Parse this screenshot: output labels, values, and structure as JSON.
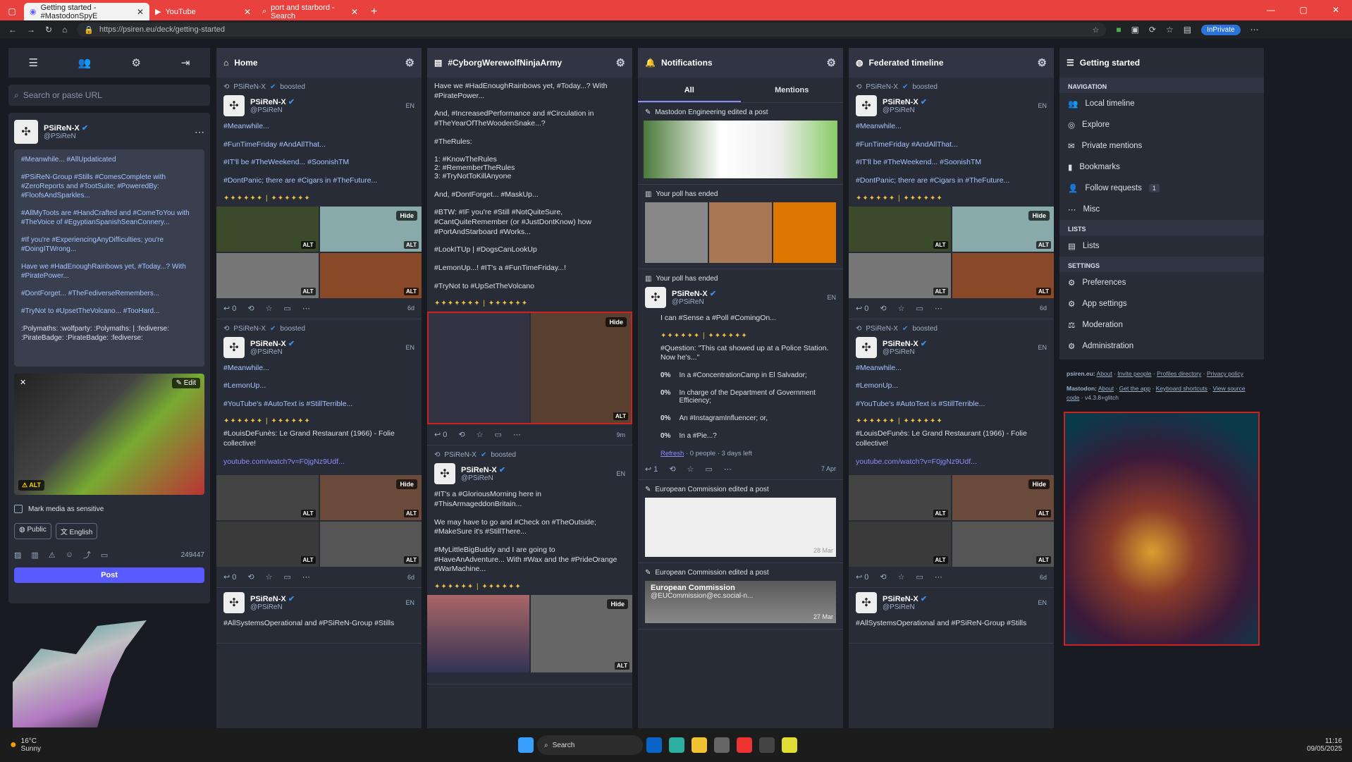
{
  "browser": {
    "tabs": [
      {
        "label": "Getting started - #MastodonSpyE",
        "active": true
      },
      {
        "label": "YouTube",
        "active": false
      },
      {
        "label": "port and starbord - Search",
        "active": false
      }
    ],
    "url": "https://psiren.eu/deck/getting-started",
    "private_label": "InPrivate",
    "colors": {
      "titlebar": "#e8413e"
    }
  },
  "compose": {
    "search_placeholder": "Search or paste URL",
    "user_name": "PSiReN-X",
    "user_handle": "@PSiReN",
    "draft": [
      "#Meanwhile... #AllUpdaticated",
      "#PSiReN-Group #Stills #ComesComplete with #ZeroReports and #TootSuite; #PoweredBy: #FloofsAndSparkles...",
      "#AllMyToots are #HandCrafted and #ComeToYou with #TheVoice of #EgyptianSpanishSeanConnery...",
      "#If you're #ExperiencingAnyDifficulties; you're #DoingITWrong...",
      "Have we #HadEnoughRainbows yet, #Today...? With #PiratePower...",
      "#DontForget... #TheFediverseRemembers...",
      "#TryNot to #UpsetTheVolcano... #TooHard...",
      ":Polymaths: :wolfparty: :Polymaths: | :fediverse: :PirateBadge: :PirateBadge: :fediverse:"
    ],
    "edit_label": "Edit",
    "alt_label": "ALT",
    "sensitive_label": "Mark media as sensitive",
    "visibility": "Public",
    "language": "English",
    "char_count": "249447",
    "post_label": "Post"
  },
  "home": {
    "title": "Home",
    "statuses": [
      {
        "boost": "PSiReN-X",
        "boosted": "boosted",
        "name": "PSiReN-X",
        "handle": "@PSiReN",
        "lang": "EN",
        "lines": [
          "#Meanwhile...",
          "#FunTimeFriday #AndAllThat...",
          "#IT'll be #TheWeekend... #SoonishTM",
          "#DontPanic; there are #Cigars in #TheFuture..."
        ],
        "time": "6d",
        "reply": "0"
      },
      {
        "boost": "PSiReN-X",
        "boosted": "boosted",
        "name": "PSiReN-X",
        "handle": "@PSiReN",
        "lang": "EN",
        "lines": [
          "#Meanwhile...",
          "#LemonUp...",
          "#YouTube's #AutoText is #StillTerrible...",
          "#LouisDeFunès: Le Grand Restaurant (1966) - Folie collective!"
        ],
        "link": "youtube.com/watch?v=F0jgNz9Udf...",
        "time": "6d",
        "reply": "0"
      },
      {
        "name": "PSiReN-X",
        "handle": "@PSiReN",
        "lang": "EN",
        "lines": [
          "#AllSystemsOperational and #PSiReN-Group #Stills"
        ]
      }
    ]
  },
  "hashtag": {
    "title": "#CyborgWerewolfNinjaArmy",
    "lines": [
      "Have we #HadEnoughRainbows yet, #Today...? With #PiratePower...",
      "And, #IncreasedPerformance and #Circulation in #TheYearOfTheWoodenSnake...?",
      "#TheRules:",
      "1: #KnowTheRules",
      "2: #RememberTheRules",
      "3: #TryNotToKillAnyone",
      "And, #DontForget... #MaskUp...",
      "#BTW: #IF you're #Still #NotQuiteSure, #CantQuiteRemember (or #JustDontKnow) how #PortAndStarboard #Works...",
      "#LookITUp | #DogsCanLookUp",
      "#LemonUp...! #IT's a #FunTimeFriday...!",
      "#TryNot to #UpSetTheVolcano"
    ],
    "time1": "9m",
    "reply1": "0",
    "boost": "PSiReN-X",
    "boosted": "boosted",
    "name": "PSiReN-X",
    "handle": "@PSiReN",
    "lang": "EN",
    "lines2": [
      "#IT's a #GloriousMorning here in #ThisArmageddonBritain...",
      "We may have to go and #Check on #TheOutside; #MakeSure it's #StillThere...",
      "#MyLittleBigBuddy and I are going to #HaveAnAdventure... With #Wax and the #PrideOrange #WarMachine..."
    ]
  },
  "notifications": {
    "title": "Notifications",
    "tab_all": "All",
    "tab_mentions": "Mentions",
    "n1": "Mastodon Engineering edited a post",
    "n2": "Your poll has ended",
    "n3": "Your poll has ended",
    "name": "PSiReN-X",
    "handle": "@PSiReN",
    "lang": "EN",
    "text1": "I can #Sense a #Poll #ComingOn...",
    "question": "#Question: \"This cat showed up at a Police Station. Now he's...\"",
    "poll": [
      {
        "pct": "0%",
        "label": "In a #ConcentrationCamp in El Salvador;"
      },
      {
        "pct": "0%",
        "label": "In charge of the Department of Government Efficiency;"
      },
      {
        "pct": "0%",
        "label": "An #InstagramInfluencer; or,"
      },
      {
        "pct": "0%",
        "label": "In a #Pie...?"
      }
    ],
    "refresh": "Refresh",
    "poll_meta": "· 0 people · 3 days left",
    "time": "7 Apr",
    "reply": "1",
    "n4": "European Commission edited a post",
    "n5": "European Commission edited a post",
    "eu_name": "European Commission",
    "eu_handle": "@EUCommission@ec.social-n...",
    "eu_time1": "28 Mar",
    "eu_time2": "27 Mar"
  },
  "federated": {
    "title": "Federated timeline"
  },
  "getting_started": {
    "title": "Getting started",
    "nav_header": "NAVIGATION",
    "nav": [
      "Local timeline",
      "Explore",
      "Private mentions",
      "Bookmarks",
      "Follow requests",
      "Misc"
    ],
    "follow_count": "1",
    "lists_header": "LISTS",
    "lists": "Lists",
    "settings_header": "SETTINGS",
    "settings": [
      "Preferences",
      "App settings",
      "Moderation",
      "Administration"
    ],
    "footer1": {
      "site": "psiren.eu:",
      "about": "About",
      "invite": "Invite people",
      "profiles": "Profiles directory",
      "privacy": "Privacy policy"
    },
    "footer2": {
      "site": "Mastodon:",
      "about": "About",
      "app": "Get the app",
      "shortcuts": "Keyboard shortcuts",
      "source": "View source code",
      "version": "v4.3.8+glitch"
    }
  },
  "taskbar": {
    "temp": "16°C",
    "weather": "Sunny",
    "search": "Search",
    "time": "11:16",
    "date": "09/05/2025"
  }
}
